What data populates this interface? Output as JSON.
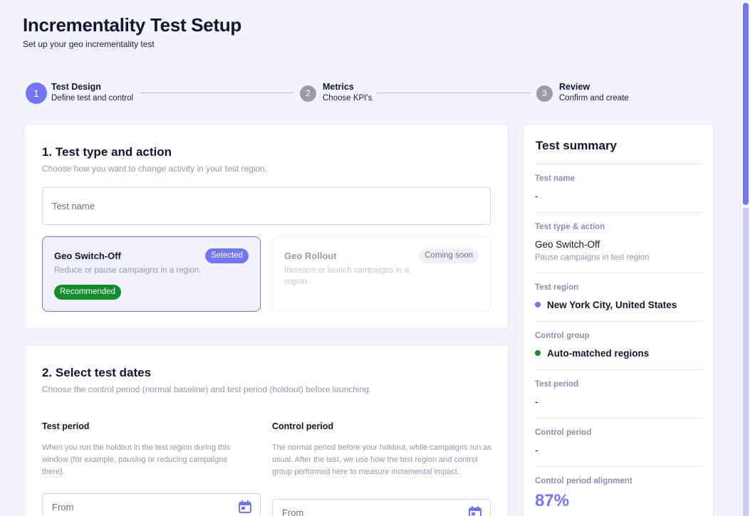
{
  "header": {
    "title": "Incrementality Test Setup",
    "subtitle": "Set up your geo incrementality test"
  },
  "stepper": [
    {
      "number": "1",
      "title": "Test Design",
      "desc": "Define test and control",
      "state": "active"
    },
    {
      "number": "2",
      "title": "Metrics",
      "desc": "Choose KPI's",
      "state": "upcoming"
    },
    {
      "number": "3",
      "title": "Review",
      "desc": "Confirm and create",
      "state": "upcoming"
    }
  ],
  "section1": {
    "title": "1. Test type and action",
    "subtitle": "Choose how you want to change activity in your test region.",
    "test_name_placeholder": "Test name",
    "options": [
      {
        "title": "Geo Switch-Off",
        "desc": "Reduce or pause campaigns in a region.",
        "badge": "Selected",
        "tag": "Recommended"
      },
      {
        "title": "Geo Rollout",
        "desc": "Increase or launch campaigns in a region.",
        "badge": "Coming soon"
      }
    ]
  },
  "section2": {
    "title": "2. Select test dates",
    "subtitle": "Choose the control period (normal baseline) and test period (holdout) before launching.",
    "test_period": {
      "label": "Test period",
      "desc": "When you run the holdout in the test region during this window (for example, pausing or reducing campaigns there).",
      "from_placeholder": "From"
    },
    "control_period": {
      "label": "Control period",
      "desc": "The normal period before your holdout, while campaigns run as usual. After the test, we use how the test region and control group performed here to measure incremental impact.",
      "from_placeholder": "From"
    }
  },
  "summary": {
    "title": "Test summary",
    "test_name_label": "Test name",
    "test_name_value": "-",
    "type_label": "Test type & action",
    "type_value": "Geo Switch-Off",
    "type_sub": "Pause campaigns in test region",
    "region_label": "Test region",
    "region_value": "New York City, United States",
    "control_label": "Control group",
    "control_value": "Auto-matched regions",
    "test_period_label": "Test period",
    "test_period_value": "-",
    "control_period_label": "Control period",
    "control_period_value": "-",
    "alignment_label": "Control period alignment",
    "alignment_value": "87%"
  },
  "colors": {
    "accent": "#7475f2",
    "success": "#138a2b",
    "muted": "#9597b2"
  },
  "icons": {
    "calendar": "calendar-icon"
  }
}
